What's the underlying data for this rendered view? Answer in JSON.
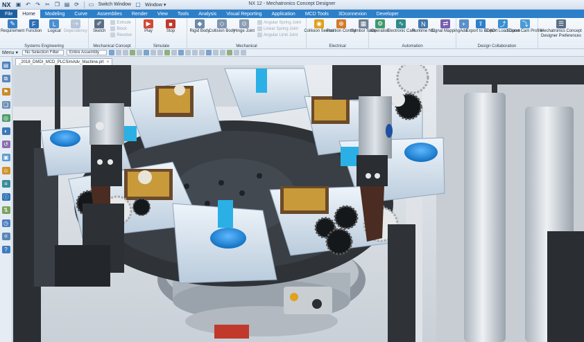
{
  "titlebar": {
    "logo": "NX",
    "switch_window": "Switch Window",
    "window_menu": "Window ▾",
    "app_title": "NX 12 - Mechatronics Concept Designer"
  },
  "tabs": [
    "File",
    "Home",
    "Modeling",
    "Curve",
    "Assemblies",
    "Render",
    "View",
    "Tools",
    "Analysis",
    "Visual Reporting",
    "Application",
    "MCD Tools",
    "3Dconnexion",
    "Developer"
  ],
  "ribbon": {
    "systems_engineering": {
      "label": "Systems Engineering",
      "buttons": [
        "Requirement",
        "Function",
        "Logical",
        "Dependency"
      ]
    },
    "mechanical_concept": {
      "label": "Mechanical Concept",
      "sketch": "Sketch",
      "stack": [
        "Extrude",
        "Block",
        "Revolve"
      ]
    },
    "simulate": {
      "label": "Simulate",
      "buttons": [
        "Play",
        "Stop"
      ]
    },
    "mechanical": {
      "label": "Mechanical",
      "buttons": [
        "Rigid Body",
        "Collision Body",
        "Hinge Joint"
      ],
      "stack": [
        "Angular Spring Joint",
        "Linear Spring Joint",
        "Angular Limit Joint"
      ]
    },
    "electrical": {
      "label": "Electrical",
      "buttons": [
        "Collision Sensor",
        "Position Control",
        "Symbol Table"
      ]
    },
    "automation": {
      "label": "Automation",
      "buttons": [
        "Operation",
        "Electronic Cam",
        "Runtime NC",
        "Signal Mapping"
      ]
    },
    "design_collaboration": {
      "label": "Design Collaboration",
      "buttons": [
        "Add",
        "Export to ECAD",
        "Export Load Curve",
        "Export Cam Profile"
      ]
    },
    "preferences": {
      "buttons": [
        "Mechatronics Concept Designer Preferences"
      ]
    }
  },
  "selection_bar": {
    "menu": "Menu ▾",
    "filter": "No Selection Filter",
    "scope": "Entire Assembly"
  },
  "document_tab": {
    "name": "_2018_DMDI_MCD_PLCSimAdv_Machine.prt",
    "close": "×"
  },
  "colors": {
    "accent": "#2c7fc9",
    "platform": "#2f3338",
    "fixture": "#d7e4f0",
    "part_blue": "#1f8fe0",
    "finger": "#4a2c22"
  },
  "icons": {
    "resource_bar": [
      "assembly-navigator-icon",
      "constraint-navigator-icon",
      "part-navigator-icon",
      "reuse-library-icon",
      "hd3d-tools-icon",
      "web-browser-icon",
      "history-icon",
      "system-materials-icon",
      "roles-icon",
      "sequence-editor-icon",
      "runtime-inspector-icon",
      "signals-icon",
      "simulation-icon",
      "physics-navigator-icon",
      "help-icon"
    ]
  }
}
